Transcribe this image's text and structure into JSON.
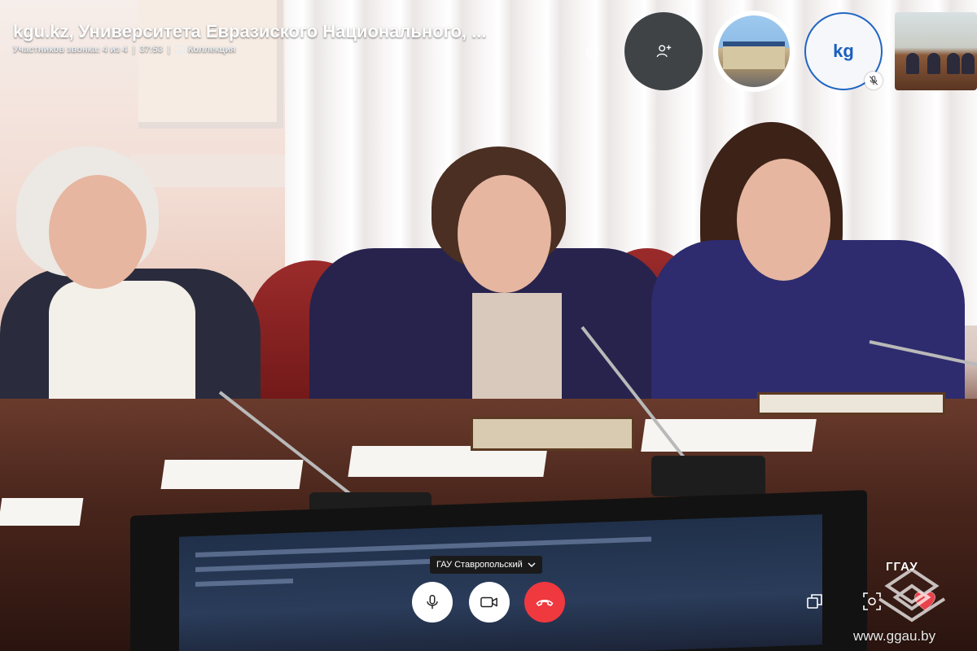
{
  "call": {
    "title": "kgu.kz, Университета Евразиского Национального, ...",
    "participants": "Участников звонка: 4 из 4",
    "duration": "37:53",
    "collection_label": "Коллекция"
  },
  "participants": {
    "avatar_initials": "kg"
  },
  "controls": {
    "device_name": "ГАУ Ставропольский"
  },
  "watermark": {
    "logo_text": "ГГАУ",
    "url": "www.ggau.by"
  },
  "colors": {
    "end_call": "#f0383f",
    "accent_blue": "#2166c3",
    "add_person_bg": "#3f4346"
  },
  "icons": {
    "settings": "gear-icon",
    "add_person": "add-person-icon",
    "mic_muted": "mic-muted-icon",
    "microphone": "microphone-icon",
    "camera": "camera-icon",
    "end_call": "phone-hangup-icon",
    "share": "share-screen-icon",
    "snapshot": "snapshot-icon",
    "reaction": "heart-icon",
    "collection": "gallery-icon",
    "device_menu": "chevron-down-icon"
  }
}
